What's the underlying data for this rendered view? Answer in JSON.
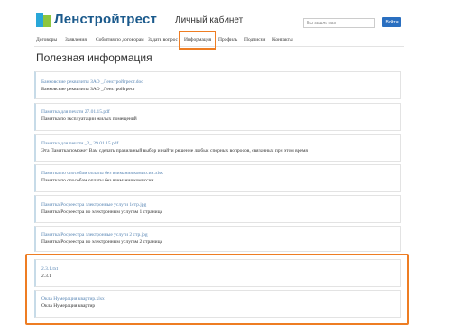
{
  "header": {
    "logo_text": "Ленстройтрест",
    "cabinet_title": "Личный кабинет",
    "search_placeholder": "Вы зашли как",
    "login_button": "Войти"
  },
  "nav": {
    "items": [
      {
        "label": "Договоры"
      },
      {
        "label": "Заявления"
      },
      {
        "label": "События по договорам"
      },
      {
        "label": "Задать вопрос"
      },
      {
        "label": "Информация",
        "active": true
      },
      {
        "label": "Профиль"
      },
      {
        "label": "Подписки"
      },
      {
        "label": "Контакты"
      }
    ]
  },
  "page": {
    "title": "Полезная информация"
  },
  "documents": [
    {
      "file": "Банковские реквизиты ЗАО _Ленстройтрест.doc",
      "description": "Банковские реквизиты ЗАО _Ленстройтрест"
    },
    {
      "file": "Памятка для печати 27.01.15.pdf",
      "description": "Памятка по эксплуатации жилых помещений"
    },
    {
      "file": "Памятка для печати _2_ 29.01.15.pdf",
      "description": "Эта Памятка поможет Вам сделать правильный выбор и найти решение любых спорных вопросов, связанных при этом время."
    },
    {
      "file": "Памятка по способам оплаты без взимания комиссии.xlsx",
      "description": "Памятка по способам оплаты без взимания комиссии"
    },
    {
      "file": "Памятка Росреестра электронные услуги 1стр.jpg",
      "description": "Памятка Росреестра по электронным услугам 1 страница"
    },
    {
      "file": "Памятка Росреестра электронные услуги 2 стр.jpg",
      "description": "Памятка Росреестра по электронным услугам 2 страница"
    },
    {
      "file": "2.3.1.txt",
      "description": "2.3.1"
    },
    {
      "file": "Окла Нумерация квартир.xlsx",
      "description": "Окла Нумерация квартир"
    }
  ],
  "colors": {
    "brand_blue": "#1b5a8c",
    "link_blue": "#5a87b5",
    "highlight_orange": "#ee7d23",
    "button_blue": "#2a6fc0"
  }
}
